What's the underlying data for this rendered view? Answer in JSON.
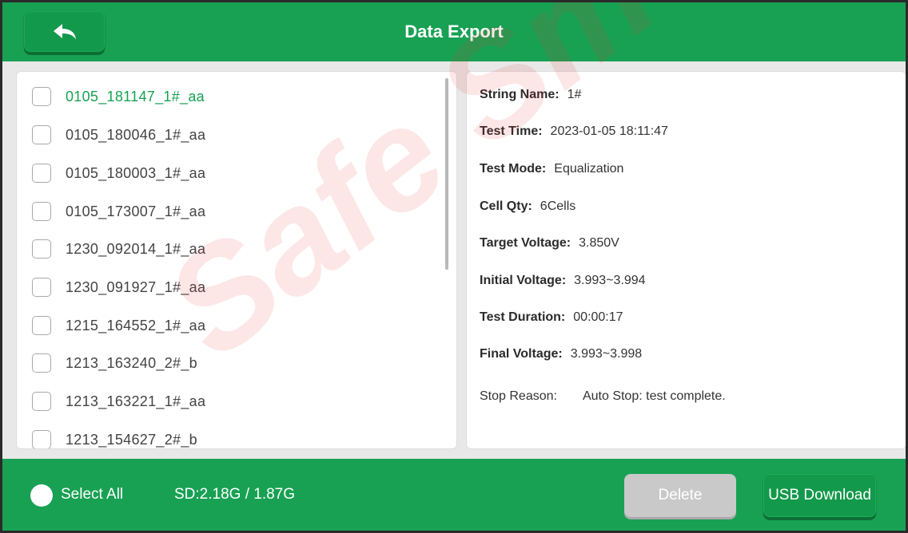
{
  "header": {
    "title": "Data Export",
    "back_icon": "back-arrow-icon"
  },
  "files": [
    {
      "name": "0105_181147_1#_aa",
      "selected": true
    },
    {
      "name": "0105_180046_1#_aa",
      "selected": false
    },
    {
      "name": "0105_180003_1#_aa",
      "selected": false
    },
    {
      "name": "0105_173007_1#_aa",
      "selected": false
    },
    {
      "name": "1230_092014_1#_aa",
      "selected": false
    },
    {
      "name": "1230_091927_1#_aa",
      "selected": false
    },
    {
      "name": "1215_164552_1#_aa",
      "selected": false
    },
    {
      "name": "1213_163240_2#_b",
      "selected": false
    },
    {
      "name": "1213_163221_1#_aa",
      "selected": false
    },
    {
      "name": "1213_154627_2#_b",
      "selected": false
    }
  ],
  "details": {
    "string_name": {
      "label": "String Name:",
      "value": "1#"
    },
    "test_time": {
      "label": "Test Time:",
      "value": "2023-01-05 18:11:47"
    },
    "test_mode": {
      "label": "Test Mode:",
      "value": "Equalization"
    },
    "cell_qty": {
      "label": "Cell Qty:",
      "value": "6Cells"
    },
    "target_voltage": {
      "label": "Target Voltage:",
      "value": "3.850V"
    },
    "initial_voltage": {
      "label": "Initial Voltage:",
      "value": "3.993~3.994"
    },
    "test_duration": {
      "label": "Test Duration:",
      "value": "00:00:17"
    },
    "final_voltage": {
      "label": "Final Voltage:",
      "value": "3.993~3.998"
    },
    "stop_reason": {
      "label": "Stop Reason:",
      "value": "Auto Stop: test complete."
    }
  },
  "footer": {
    "select_all_label": "Select All",
    "sd_info": "SD:2.18G / 1.87G",
    "delete_label": "Delete",
    "usb_download_label": "USB Download"
  },
  "watermark": "Safe Sm",
  "colors": {
    "accent_green": "#18a153",
    "selected_text": "#18a153",
    "disabled_button": "#c9c9c9"
  }
}
